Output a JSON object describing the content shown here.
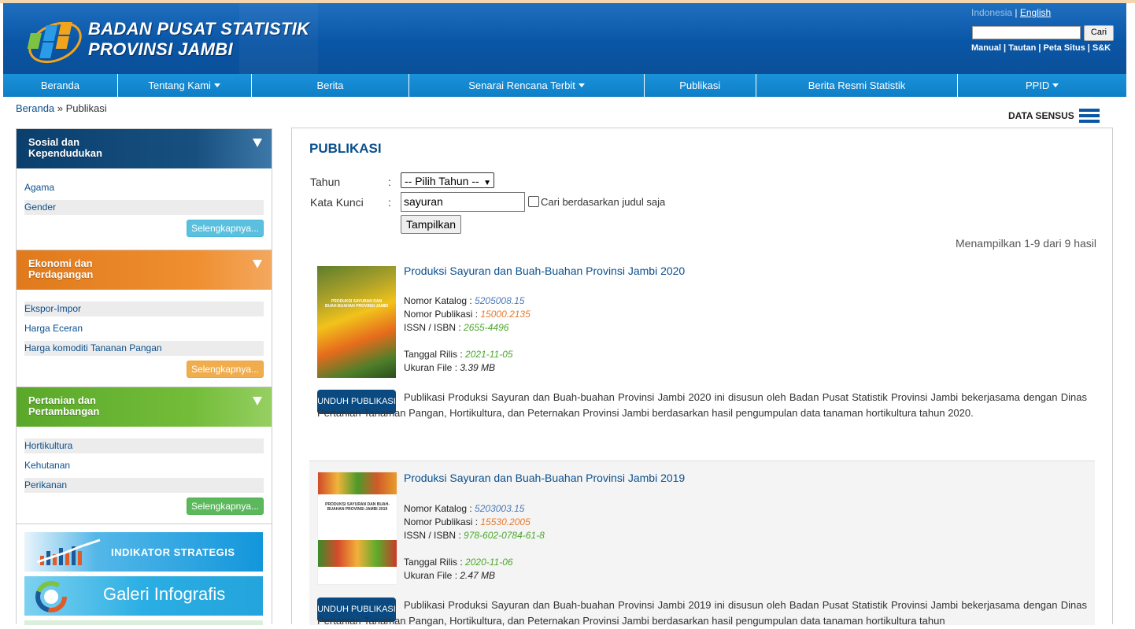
{
  "header": {
    "org_line1": "BADAN PUSAT STATISTIK",
    "org_line2": "PROVINSI JAMBI",
    "lang_id": "Indonesia",
    "lang_sep": " | ",
    "lang_en": "English",
    "search_button": "Cari",
    "links": "Manual | Tautan | Peta Situs | S&K"
  },
  "nav": [
    {
      "label": "Beranda",
      "dropdown": false
    },
    {
      "label": "Tentang Kami",
      "dropdown": true
    },
    {
      "label": "Berita",
      "dropdown": false
    },
    {
      "label": "Senarai Rencana Terbit",
      "dropdown": true
    },
    {
      "label": "Publikasi",
      "dropdown": false
    },
    {
      "label": "Berita Resmi Statistik",
      "dropdown": false
    },
    {
      "label": "PPID",
      "dropdown": true
    }
  ],
  "breadcrumb": {
    "home": "Beranda",
    "sep": " » ",
    "current": "Publikasi"
  },
  "data_sensus": "DATA SENSUS",
  "sidebar": {
    "categories": [
      {
        "title": "Sosial dan Kependudukan",
        "line1": "Sosial dan",
        "line2": "Kependudukan",
        "items": [
          "Agama",
          "Gender"
        ],
        "more": "Selengkapnya..."
      },
      {
        "title": "Ekonomi dan Perdagangan",
        "line1": "Ekonomi dan",
        "line2": "Perdagangan",
        "items": [
          "Ekspor-Impor",
          "Harga Eceran",
          "Harga komoditi Tananan Pangan"
        ],
        "more": "Selengkapnya..."
      },
      {
        "title": "Pertanian dan Pertambangan",
        "line1": "Pertanian dan",
        "line2": "Pertambangan",
        "items": [
          "Hortikultura",
          "Kehutanan",
          "Perikanan"
        ],
        "more": "Selengkapnya..."
      }
    ],
    "banners": [
      "INDIKATOR STRATEGIS",
      "Galeri Infografis"
    ]
  },
  "main": {
    "title": "PUBLIKASI",
    "form": {
      "tahun_label": "Tahun",
      "kata_label": "Kata Kunci",
      "colon": ":",
      "tahun_value": "-- Pilih Tahun --",
      "kata_value": "sayuran",
      "checkbox_label": "Cari berdasarkan judul saja",
      "checkbox_checked": false,
      "submit": "Tampilkan"
    },
    "result_count": "Menampilkan 1-9 dari 9 hasil",
    "publications": [
      {
        "title": "Produksi Sayuran dan Buah-Buahan Provinsi Jambi 2020",
        "katalog_label": "Nomor Katalog : ",
        "katalog": "5205008.15",
        "publikasi_label": "Nomor Publikasi : ",
        "publikasi": "15000.2135",
        "issn_label": "ISSN / ISBN : ",
        "issn": "2655-4496",
        "rilis_label": "Tanggal Rilis : ",
        "rilis": "2021-11-05",
        "ukuran_label": "Ukuran File : ",
        "ukuran": "3.39 MB",
        "download": "UNDUH PUBLIKASI",
        "cover_text": "PRODUKSI SAYURAN DAN BUAH-BUAHAN PROVINSI JAMBI",
        "description": "Publikasi Produksi Sayuran dan Buah-buahan Provinsi Jambi 2020 ini disusun oleh Badan Pusat Statistik Provinsi Jambi bekerjasama dengan Dinas Pertanian Tanaman Pangan, Hortikultura, dan Peternakan Provinsi Jambi berdasarkan hasil pengumpulan data tanaman hortikultura tahun 2020."
      },
      {
        "title": "Produksi Sayuran dan Buah-Buahan Provinsi Jambi 2019",
        "katalog_label": "Nomor Katalog : ",
        "katalog": "5203003.15",
        "publikasi_label": "Nomor Publikasi : ",
        "publikasi": "15530.2005",
        "issn_label": "ISSN / ISBN : ",
        "issn": "978-602-0784-61-8",
        "rilis_label": "Tanggal Rilis : ",
        "rilis": "2020-11-06",
        "ukuran_label": "Ukuran File : ",
        "ukuran": "2.47 MB",
        "download": "UNDUH PUBLIKASI",
        "cover_text": "PRODUKSI SAYURAN DAN BUAH-BUAHAN PROVINSI JAMBI 2019",
        "description": "Publikasi Produksi Sayuran dan Buah-buahan Provinsi Jambi 2019 ini disusun oleh Badan Pusat Statistik Provinsi Jambi bekerjasama dengan Dinas Pertanian Tanaman Pangan, Hortikultura, dan Peternakan Provinsi Jambi berdasarkan hasil pengumpulan data tanaman hortikultura tahun"
      }
    ]
  },
  "colors": {
    "brand_blue": "#0a56a6",
    "nav_blue": "#1a91d9",
    "link": "#0a4f8d",
    "download_btn": "#0b4a80"
  },
  "icons": [
    "bps-logo-icon",
    "hamburger-menu-icon",
    "dropdown-caret-icon",
    "collapse-triangle-icon"
  ]
}
